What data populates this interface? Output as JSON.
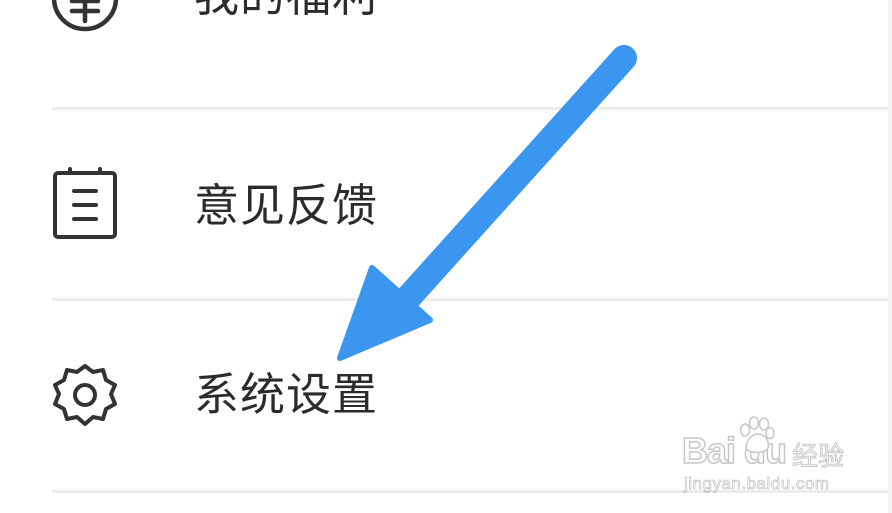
{
  "menu": {
    "items": [
      {
        "label": "我的福利",
        "icon": "yuan-coin-icon"
      },
      {
        "label": "意见反馈",
        "icon": "clipboard-icon"
      },
      {
        "label": "系统设置",
        "icon": "gear-icon"
      }
    ]
  },
  "annotation": {
    "arrow_color": "#3a96ee",
    "arrow_target": "系统设置"
  },
  "watermark": {
    "brand": "Bai du",
    "name": "经验",
    "url": "jingyan.baidu.com"
  },
  "colors": {
    "background": "#ffffff",
    "text": "#2b2b2b",
    "icon_stroke": "#333333",
    "divider": "#ececec"
  }
}
